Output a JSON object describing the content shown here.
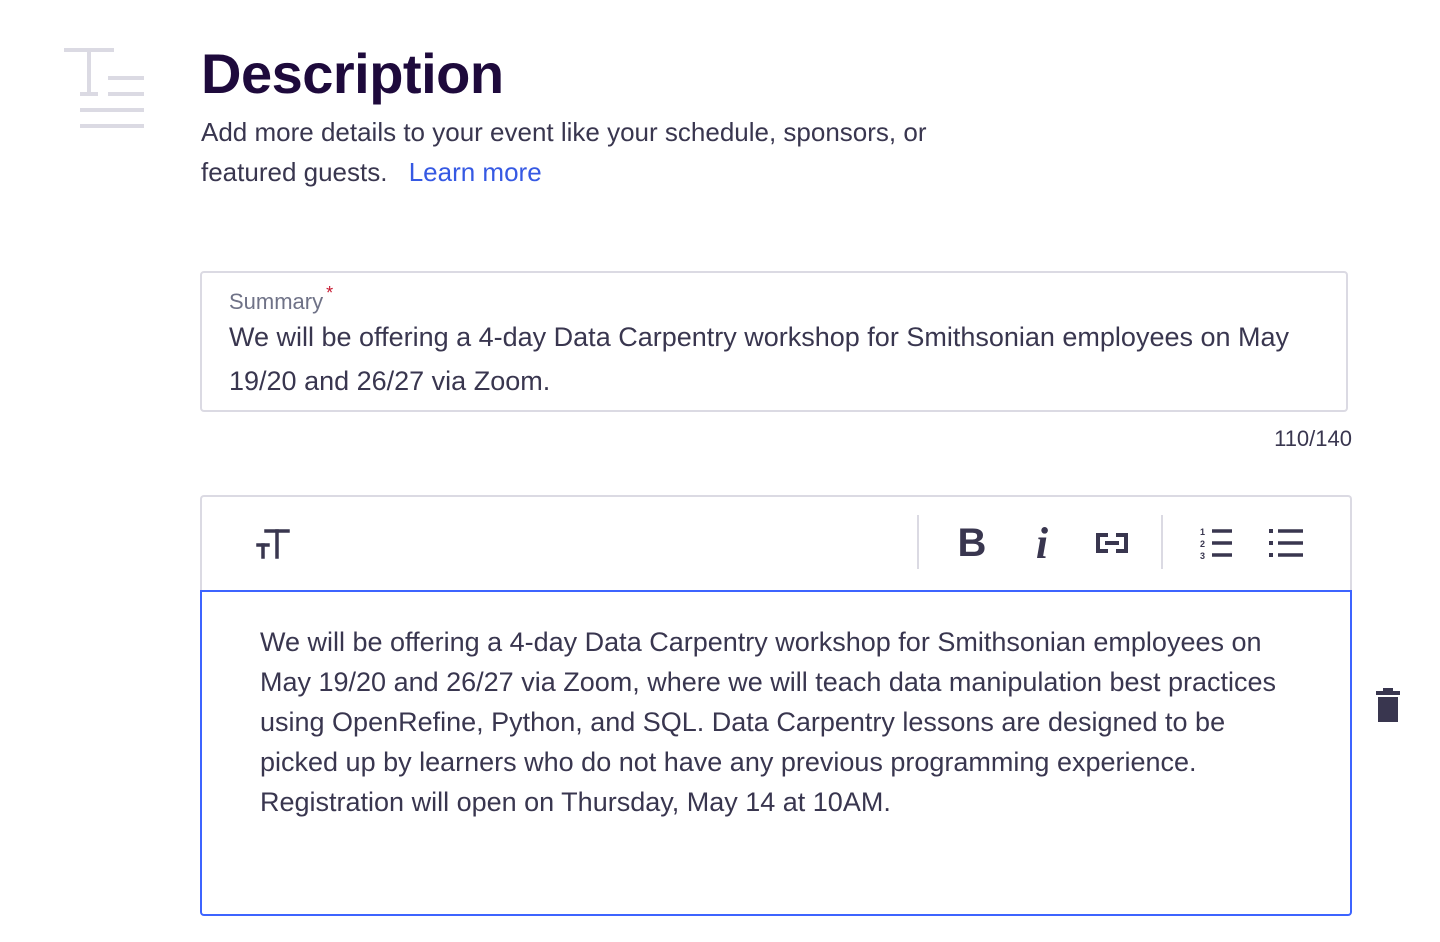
{
  "section": {
    "icon": "text-paragraph-icon",
    "title": "Description",
    "subtitle": "Add more details to your event like your schedule, sponsors, or featured guests.",
    "learn_more": "Learn more"
  },
  "summary": {
    "label": "Summary",
    "required_marker": "*",
    "value": "We will be offering a 4-day Data Carpentry workshop for Smithsonian employees on May 19/20 and 26/27 via Zoom.",
    "char_count": "110/140"
  },
  "toolbar": {
    "buttons": [
      {
        "name": "text-size-icon",
        "label": "T"
      },
      {
        "name": "bold-icon",
        "label": "B"
      },
      {
        "name": "italic-icon",
        "label": "i"
      },
      {
        "name": "link-icon",
        "label": ""
      },
      {
        "name": "numbered-list-icon",
        "label": ""
      },
      {
        "name": "bulleted-list-icon",
        "label": ""
      }
    ]
  },
  "editor": {
    "text": "We will be offering a 4-day Data Carpentry workshop for Smithsonian employees on May 19/20 and 26/27 via Zoom, where we will teach data manipulation best practices using OpenRefine, Python, and SQL. Data Carpentry lessons are designed to be picked up by learners who do not have any previous programming experience. Registration will open on Thursday, May 14 at 10AM."
  },
  "actions": {
    "delete_icon": "trash-icon"
  },
  "colors": {
    "title": "#1e0a3c",
    "body_text": "#39364f",
    "link": "#3659e3",
    "focus_border": "#3d64ff",
    "border": "#dbdae3",
    "required": "#c5162e",
    "icon_light": "#dbdae3"
  }
}
